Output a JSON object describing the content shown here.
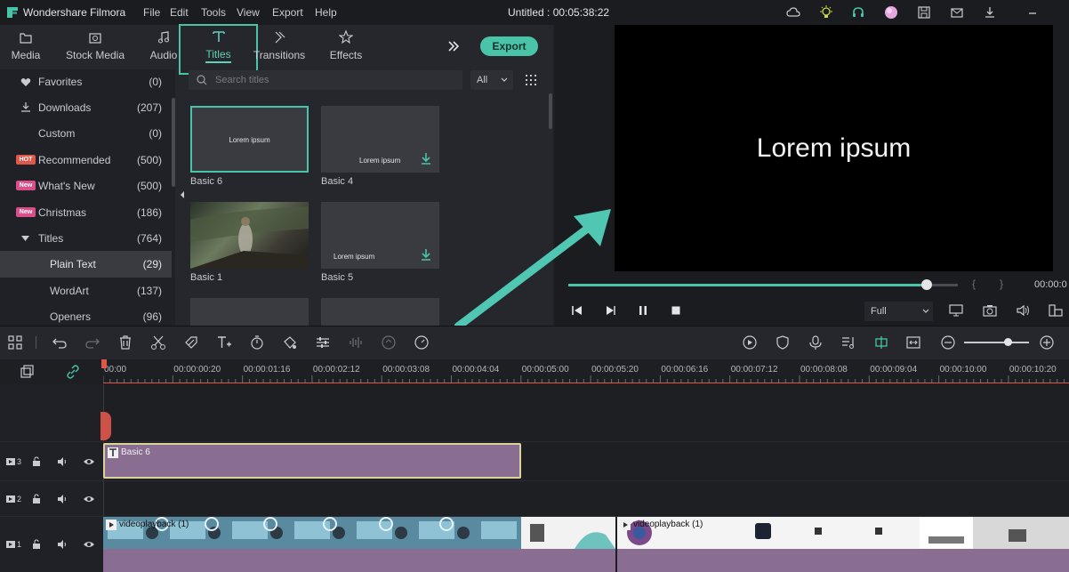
{
  "app": {
    "name": "Wondershare Filmora",
    "doc_title": "Untitled : 00:05:38:22"
  },
  "menu": [
    "File",
    "Edit",
    "Tools",
    "View",
    "Export",
    "Help"
  ],
  "tabs": [
    {
      "label": "Media",
      "icon": "folder-icon"
    },
    {
      "label": "Stock Media",
      "icon": "stock-media-icon"
    },
    {
      "label": "Audio",
      "icon": "music-note-icon"
    },
    {
      "label": "Titles",
      "icon": "text-t-icon",
      "active": true
    },
    {
      "label": "Transitions",
      "icon": "transitions-icon"
    },
    {
      "label": "Effects",
      "icon": "effects-icon"
    }
  ],
  "export_label": "Export",
  "sidebar": [
    {
      "label": "Favorites",
      "count": "(0)",
      "icon": "heart-icon"
    },
    {
      "label": "Downloads",
      "count": "(207)",
      "icon": "download-icon"
    },
    {
      "label": "Custom",
      "count": "(0)"
    },
    {
      "label": "Recommended",
      "count": "(500)",
      "badge": "HOT"
    },
    {
      "label": "What's New",
      "count": "(500)",
      "badge": "New"
    },
    {
      "label": "Christmas",
      "count": "(186)",
      "badge": "New"
    },
    {
      "label": "Titles",
      "count": "(764)",
      "icon": "caret-down-icon"
    },
    {
      "label": "Plain Text",
      "count": "(29)",
      "active": true
    },
    {
      "label": "WordArt",
      "count": "(137)"
    },
    {
      "label": "Openers",
      "count": "(96)"
    }
  ],
  "search": {
    "placeholder": "Search titles"
  },
  "filter": {
    "value": "All"
  },
  "thumbs": [
    {
      "label": "Basic 6",
      "text": "Lorem ipsum"
    },
    {
      "label": "Basic 4",
      "text": "Lorem ipsum"
    },
    {
      "label": "Basic 1",
      "text": ""
    },
    {
      "label": "Basic 5",
      "text": "Lorem ipsum"
    }
  ],
  "preview": {
    "text": "Lorem ipsum",
    "timecode": "00:00:0",
    "zoom": "Full"
  },
  "ruler_ticks": [
    "00:00",
    "00:00:00:20",
    "00:00:01:16",
    "00:00:02:12",
    "00:00:03:08",
    "00:00:04:04",
    "00:00:05:00",
    "00:00:05:20",
    "00:00:06:16",
    "00:00:07:12",
    "00:00:08:08",
    "00:00:09:04",
    "00:00:10:00",
    "00:00:10:20",
    "00:00"
  ],
  "tracks": [
    {
      "num": "3"
    },
    {
      "num": "2"
    },
    {
      "num": "1"
    }
  ],
  "clips": {
    "title": "Basic 6",
    "video1": "videoplayback (1)",
    "video2": "videoplayback (1)"
  },
  "colors": {
    "accent": "#49c4a9",
    "clip": "#8a6e92",
    "clip_border": "#d9d59a",
    "playhead": "#e0574a"
  }
}
